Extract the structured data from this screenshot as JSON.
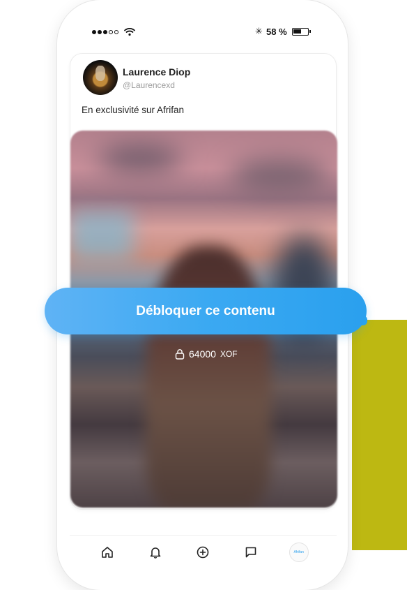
{
  "status_bar": {
    "battery_percent": "58 %",
    "battery_level": 0.58
  },
  "post": {
    "author_name": "Laurence Diop",
    "author_handle": "@Laurencexd",
    "text": "En exclusivité sur Afrifan"
  },
  "unlock": {
    "button_label": "Débloquer ce contenu",
    "price_amount": "64000",
    "price_currency": "XOF"
  },
  "bottom_nav": {
    "items": [
      "home-icon",
      "bell-icon",
      "plus-circle-icon",
      "chat-icon",
      "profile-avatar"
    ],
    "profile_label": "Afrifan"
  },
  "colors": {
    "accent": "#2aa0ee",
    "side_panel": "#bdb812"
  }
}
